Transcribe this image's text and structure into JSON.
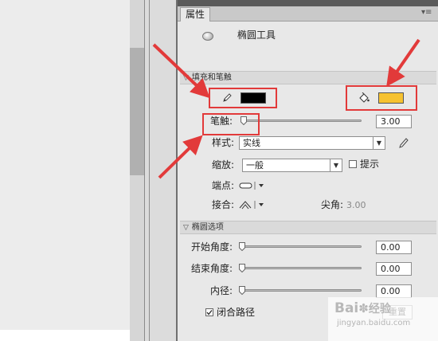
{
  "panel": {
    "tab_label": "属性",
    "tool_name": "椭圆工具"
  },
  "fill_stroke": {
    "section_label": "填充和笔触",
    "stroke_color": "#000000",
    "fill_color": "#f6c230",
    "stroke_label": "笔触:",
    "stroke_value": "3.00",
    "style_label": "样式:",
    "style_value": "实线",
    "scale_label": "缩放:",
    "scale_value": "一般",
    "hint_label": "提示",
    "cap_label": "端点:",
    "join_label": "接合:",
    "miter_label": "尖角:",
    "miter_value": "3.00"
  },
  "ellipse": {
    "section_label": "椭圆选项",
    "start_angle_label": "开始角度:",
    "start_angle_value": "0.00",
    "end_angle_label": "结束角度:",
    "end_angle_value": "0.00",
    "inner_radius_label": "内径:",
    "inner_radius_value": "0.00",
    "close_path_label": "闭合路径",
    "reset_button": "重置"
  },
  "watermark": {
    "brand": "Bai",
    "brand2": "经验",
    "url": "jingyan.baidu.com"
  },
  "colors": {
    "annotation_red": "#e23a3a"
  }
}
